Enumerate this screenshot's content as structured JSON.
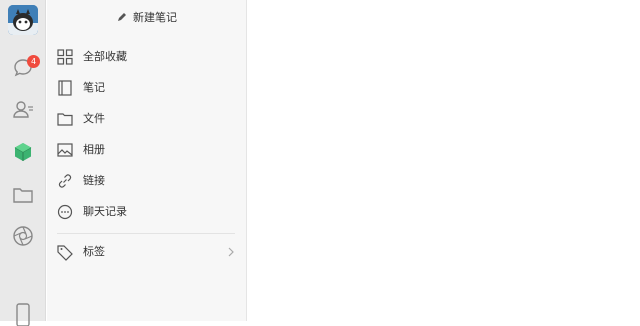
{
  "rail": {
    "icons": [
      "chat-icon",
      "contacts-icon",
      "cube-icon",
      "folder-icon",
      "aperture-icon",
      "phone-icon"
    ],
    "chat_badge": "4",
    "accent": "#3cb371"
  },
  "panel": {
    "new_note_label": "新建笔记",
    "items": [
      {
        "label": "全部收藏",
        "icon": "grid-icon"
      },
      {
        "label": "笔记",
        "icon": "notebook-icon"
      },
      {
        "label": "文件",
        "icon": "folder-icon"
      },
      {
        "label": "相册",
        "icon": "image-icon"
      },
      {
        "label": "链接",
        "icon": "link-icon"
      },
      {
        "label": "聊天记录",
        "icon": "chat-bubble-icon"
      },
      {
        "label": "标签",
        "icon": "tag-icon"
      }
    ]
  },
  "colors": {
    "rail_bg": "#e9e9e9",
    "panel_bg": "#f7f7f7",
    "badge": "#f04b3e"
  }
}
